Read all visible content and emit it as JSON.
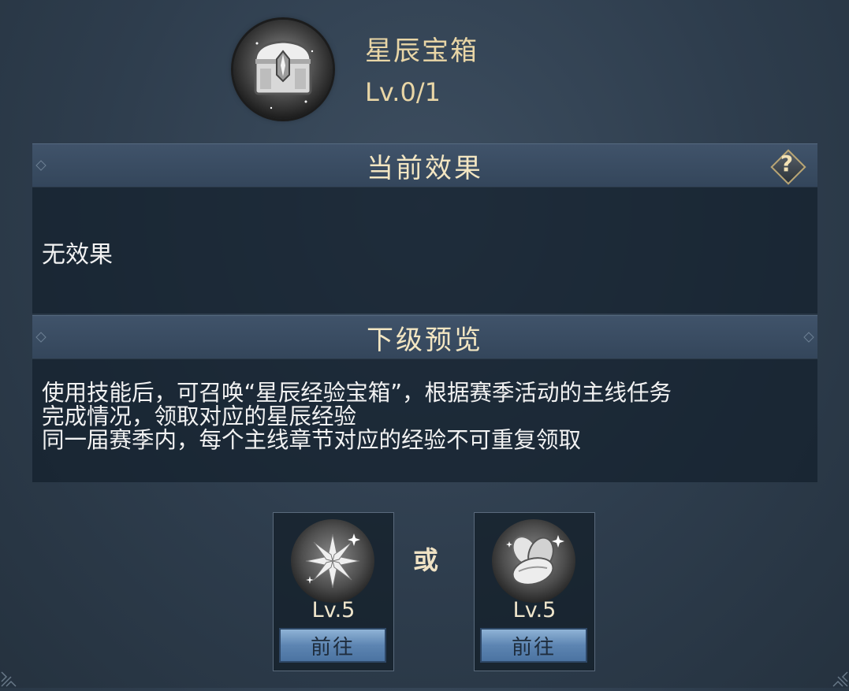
{
  "header": {
    "icon": "star-chest-icon",
    "title": "星辰宝箱",
    "level": "Lv.0/1"
  },
  "current_effect": {
    "title": "当前效果",
    "help_label": "?",
    "text": "无效果"
  },
  "next_preview": {
    "title": "下级预览",
    "lines": [
      "使用技能后，可召唤“星辰经验宝箱”，根据赛季活动的主线任务",
      "完成情况，领取对应的星辰经验",
      "同一届赛季内，每个主线章节对应的经验不可重复领取"
    ]
  },
  "options": [
    {
      "icon": "crystal-burst-icon",
      "level": "Lv.5",
      "button": "前往"
    },
    {
      "icon": "seed-stones-icon",
      "level": "Lv.5",
      "button": "前往"
    }
  ],
  "or_label": "或",
  "colors": {
    "background": "#2e3d4d",
    "title_gold": "#e9d6a6",
    "button_blue": "#5d85b2"
  }
}
